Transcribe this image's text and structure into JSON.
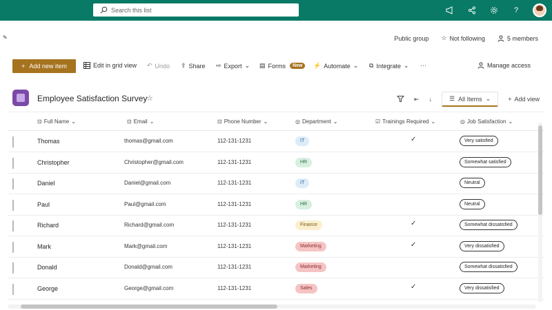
{
  "topbar": {
    "search_placeholder": "Search this list",
    "icons": [
      "megaphone-icon",
      "share-icon",
      "gear-icon",
      "help-icon",
      "avatar"
    ]
  },
  "group": {
    "privacy": "Public group",
    "follow": "Not following",
    "members": "5 members"
  },
  "commands": {
    "new_item": "Add new item",
    "grid_view": "Edit in grid view",
    "undo": "Undo",
    "share": "Share",
    "export": "Export",
    "forms": "Forms",
    "forms_badge": "New",
    "automate": "Automate",
    "integrate": "Integrate",
    "more": "···",
    "manage_access": "Manage access"
  },
  "list": {
    "title": "Employee Satisfaction Survey",
    "view": "All Items",
    "add_view": "Add view"
  },
  "columns": {
    "full_name": "Full Name",
    "email": "Email",
    "phone": "Phone Number",
    "department": "Department",
    "trainings": "Trainings Required",
    "satisfaction": "Job Satisfaction"
  },
  "rows": [
    {
      "name": "Thomas",
      "email": "thomas@gmail.com",
      "phone": "112-131-1231",
      "department": "IT",
      "training": true,
      "satisfaction": "Very satisfied"
    },
    {
      "name": "Christopher",
      "email": "Christopher@gmail.com",
      "phone": "112-131-1231",
      "department": "HR",
      "training": false,
      "satisfaction": "Somewhat satisfied"
    },
    {
      "name": "Daniel",
      "email": "Daniel@gmail.com",
      "phone": "112-131-1231",
      "department": "IT",
      "training": false,
      "satisfaction": "Neutral"
    },
    {
      "name": "Paul",
      "email": "Paul@gmail.com",
      "phone": "112-131-1231",
      "department": "HR",
      "training": false,
      "satisfaction": "Neutral"
    },
    {
      "name": "Richard",
      "email": "Richard@gmail.com",
      "phone": "112-131-1231",
      "department": "Finance",
      "training": true,
      "satisfaction": "Somewhat dissatisfied"
    },
    {
      "name": "Mark",
      "email": "Mark@gmail.com",
      "phone": "112-131-1231",
      "department": "Marketing",
      "training": true,
      "satisfaction": "Very dissatisfied"
    },
    {
      "name": "Donald",
      "email": "Donald@gmail.com",
      "phone": "112-131-1231",
      "department": "Marketing",
      "training": false,
      "satisfaction": "Somewhat dissatisfied"
    },
    {
      "name": "George",
      "email": "George@gmail.com",
      "phone": "112-131-1231",
      "department": "Sales",
      "training": true,
      "satisfaction": "Very dissatisfied"
    }
  ],
  "department_colors": {
    "IT": {
      "bg": "#dcecf8",
      "fg": "#2a5f8a"
    },
    "HR": {
      "bg": "#d7f0e0",
      "fg": "#2e6b45"
    },
    "Finance": {
      "bg": "#fbefcf",
      "fg": "#7a5a14"
    },
    "Marketing": {
      "bg": "#f6c4c4",
      "fg": "#8a2d2d"
    },
    "Sales": {
      "bg": "#f6c4c4",
      "fg": "#8a2d2d"
    }
  },
  "colors": {
    "header": "#087a66",
    "accent": "#a6731f",
    "list_icon": "#7b4aa8"
  }
}
